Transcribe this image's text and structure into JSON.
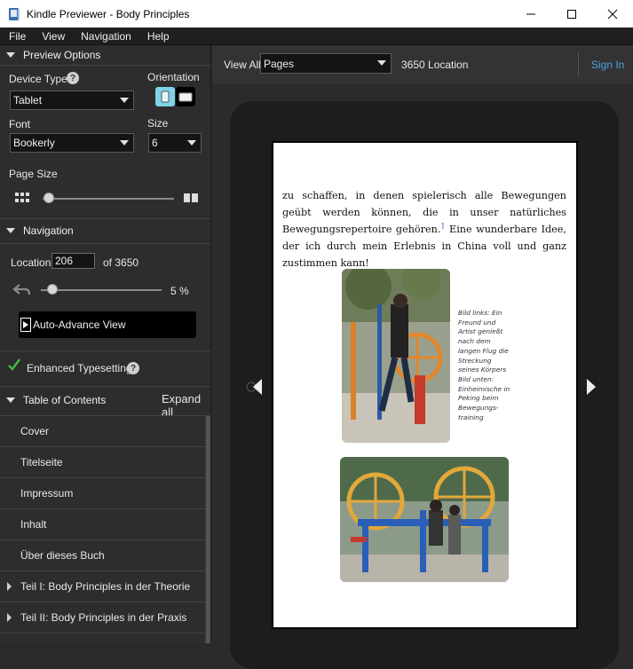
{
  "window": {
    "title": "Kindle Previewer - Body Principles"
  },
  "menu": [
    "File",
    "View",
    "Navigation",
    "Help"
  ],
  "preview_options": {
    "header": "Preview Options",
    "device_type_label": "Device Type",
    "device_type_value": "Tablet",
    "orientation_label": "Orientation",
    "font_label": "Font",
    "font_value": "Bookerly",
    "size_label": "Size",
    "size_value": "6",
    "page_size_label": "Page Size"
  },
  "navigation": {
    "header": "Navigation",
    "location_label": "Location",
    "location_value": "206",
    "of_total": "of 3650",
    "progress_percent": "5 %",
    "progress_fraction": 0.05,
    "auto_advance_label": "Auto-Advance View"
  },
  "enhanced": {
    "label": "Enhanced Typesetting",
    "check_color": "#3fbf3f"
  },
  "toc": {
    "header": "Table of Contents",
    "expand_all": "Expand all",
    "items": [
      {
        "label": "Cover",
        "expandable": false
      },
      {
        "label": "Titelseite",
        "expandable": false
      },
      {
        "label": "Impressum",
        "expandable": false
      },
      {
        "label": "Inhalt",
        "expandable": false
      },
      {
        "label": "Über dieses Buch",
        "expandable": false
      },
      {
        "label": "Teil I: Body Principles in der Theorie",
        "expandable": true
      },
      {
        "label": "Teil II: Body Principles in der Praxis",
        "expandable": true
      }
    ]
  },
  "toolbar": {
    "view_all_label": "View All",
    "view_mode_value": "Pages",
    "location_readout": "3650 Location",
    "sign_in": "Sign In"
  },
  "page": {
    "paragraph_before": "zu schaffen, in denen spielerisch alle Bewegungen geübt werden können, die in unser natürliches Bewegungsrepertoire gehören.",
    "footnote_ref": "1",
    "paragraph_after": " Eine wunderbare Idee, der ich durch mein Erlebnis in China voll und ganz zustimmen kann!",
    "caption": "Bild links: Ein Freund und Artist genießt nach dem langen Flug die Streckung seines Körpers Bild unten: Einheimische in Peking beim Bewegungs-training"
  },
  "colors": {
    "accent_link": "#4aa3df",
    "orientation_active": "#7fd3e8"
  }
}
